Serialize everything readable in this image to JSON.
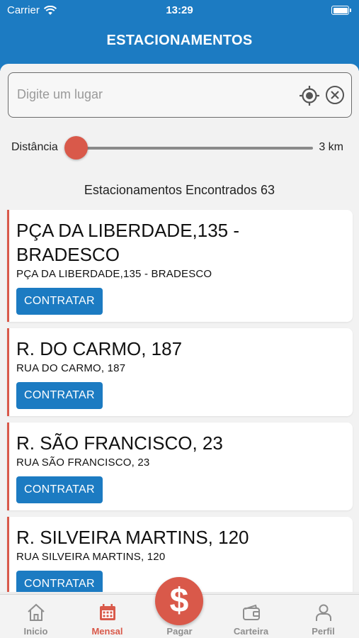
{
  "status": {
    "carrier": "Carrier",
    "time": "13:29"
  },
  "header": {
    "title": "ESTACIONAMENTOS"
  },
  "search": {
    "placeholder": "Digite um lugar",
    "value": ""
  },
  "distance": {
    "label": "Distância",
    "value_text": "3 km",
    "level": 0.0
  },
  "results": {
    "text": "Estacionamentos Encontrados 63"
  },
  "colors": {
    "primary": "#1c7bc2",
    "accent": "#d9594a"
  },
  "parkings": [
    {
      "name": "PÇA DA LIBERDADE,135 - BRADESCO",
      "address": "PÇA DA LIBERDADE,135 - BRADESCO",
      "button": "CONTRATAR"
    },
    {
      "name": "R. DO CARMO, 187",
      "address": "RUA DO CARMO, 187",
      "button": "CONTRATAR"
    },
    {
      "name": "R. SÃO FRANCISCO, 23",
      "address": "RUA SÃO FRANCISCO, 23",
      "button": "CONTRATAR"
    },
    {
      "name": "R. SILVEIRA MARTINS, 120",
      "address": "RUA SILVEIRA MARTINS, 120",
      "button": "CONTRATAR"
    }
  ],
  "tabs": [
    {
      "label": "Inicio",
      "icon": "home-icon",
      "active": false
    },
    {
      "label": "Mensal",
      "icon": "calendar-icon",
      "active": true
    },
    {
      "label": "Pagar",
      "icon": "dollar-icon",
      "active": false
    },
    {
      "label": "Carteira",
      "icon": "wallet-icon",
      "active": false
    },
    {
      "label": "Perfil",
      "icon": "person-icon",
      "active": false
    }
  ],
  "pay_symbol": "$"
}
